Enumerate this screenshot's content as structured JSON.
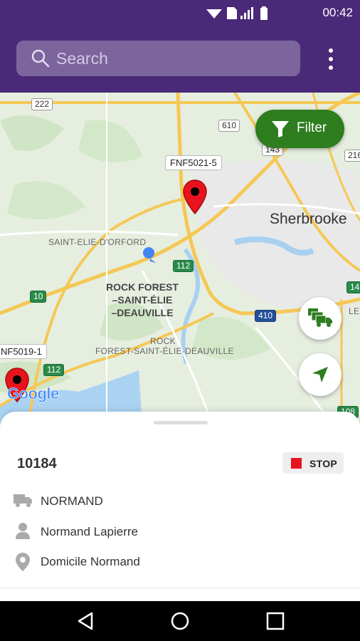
{
  "status_bar": {
    "time": "00:42",
    "icons": [
      "wifi-icon",
      "sim-icon",
      "signal-icon",
      "battery-icon"
    ]
  },
  "app_bar": {
    "search_placeholder": "Search",
    "menu_icon": "more-vertical-icon"
  },
  "map": {
    "filter_label": "Filter",
    "city": "Sherbrooke",
    "district": [
      "ROCK FOREST",
      "–SAINT-ÉLIE",
      "–DEAUVILLE"
    ],
    "area_labels": [
      "SAINT-ELIE-D'ORFORD",
      "ROCK",
      "FOREST-SAINT-ÉLIE-DEAUVILLE"
    ],
    "route_shields": [
      "222",
      "610",
      "143",
      "216",
      "112",
      "10",
      "410",
      "112",
      "14",
      "108"
    ],
    "markers": [
      {
        "label": "FNF5021-5",
        "color": "#e8141d"
      },
      {
        "label": "NF5019-1",
        "color": "#e8141d"
      }
    ],
    "map_credit": "Google",
    "edge_label": "LEN"
  },
  "sheet": {
    "vehicle_id": "10184",
    "status": {
      "label": "STOP",
      "color": "#e8141d"
    },
    "details": [
      {
        "icon": "truck-icon",
        "text": "NORMAND"
      },
      {
        "icon": "person-icon",
        "text": "Normand Lapierre"
      },
      {
        "icon": "location-pin-icon",
        "text": "Domicile Normand"
      }
    ]
  },
  "colors": {
    "app_bar": "#4a2a78",
    "filter_button": "#2e7d1f",
    "fab_icon": "#2e7d1f"
  }
}
